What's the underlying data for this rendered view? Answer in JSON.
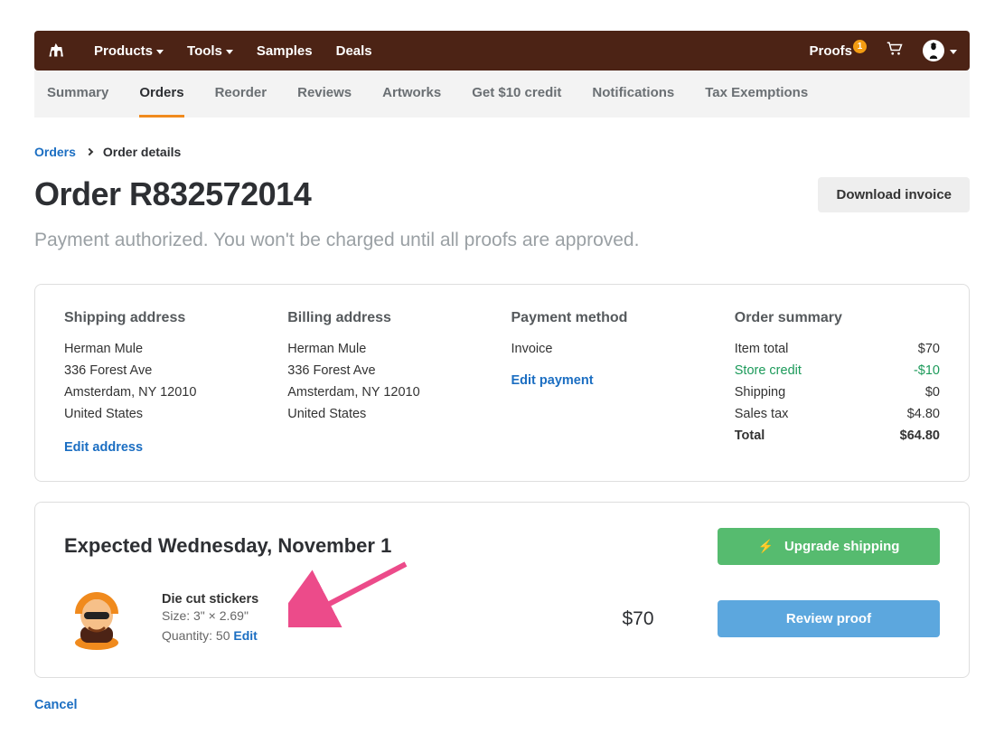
{
  "topnav": {
    "products": "Products",
    "tools": "Tools",
    "samples": "Samples",
    "deals": "Deals",
    "proofs": "Proofs",
    "proofs_badge": "1"
  },
  "subnav": [
    "Summary",
    "Orders",
    "Reorder",
    "Reviews",
    "Artworks",
    "Get $10 credit",
    "Notifications",
    "Tax Exemptions"
  ],
  "subnav_active_index": 1,
  "breadcrumb": {
    "orders": "Orders",
    "current": "Order details"
  },
  "page_title": "Order R832572014",
  "download_invoice": "Download invoice",
  "payment_msg": "Payment authorized. You won't be charged until all proofs are approved.",
  "sections": {
    "shipping_title": "Shipping address",
    "billing_title": "Billing address",
    "payment_title": "Payment method",
    "summary_title": "Order summary"
  },
  "shipping": {
    "name": "Herman Mule",
    "line1": "336 Forest Ave",
    "line2": "Amsterdam, NY 12010",
    "country": "United States",
    "edit": "Edit address"
  },
  "billing": {
    "name": "Herman Mule",
    "line1": "336 Forest Ave",
    "line2": "Amsterdam, NY 12010",
    "country": "United States"
  },
  "payment": {
    "label": "Invoice",
    "edit": "Edit payment"
  },
  "summary": {
    "item_total_label": "Item total",
    "item_total_value": "$70",
    "credit_label": "Store credit",
    "credit_value": "-$10",
    "shipping_label": "Shipping",
    "shipping_value": "$0",
    "tax_label": "Sales tax",
    "tax_value": "$4.80",
    "total_label": "Total",
    "total_value": "$64.80"
  },
  "expected": "Expected Wednesday, November 1",
  "upgrade_shipping": "Upgrade shipping",
  "review_proof": "Review proof",
  "item": {
    "name": "Die cut stickers",
    "size": "Size: 3\" × 2.69\"",
    "qty_prefix": "Quantity: 50",
    "edit": "Edit",
    "price": "$70"
  },
  "cancel": "Cancel"
}
